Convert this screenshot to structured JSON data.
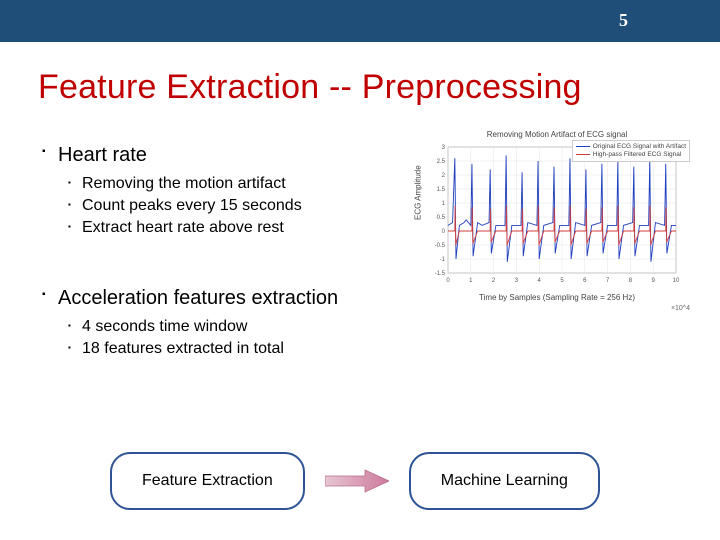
{
  "header": {
    "page_number": "5",
    "accent_color": "#1f4e79"
  },
  "title": "Feature Extraction -- Preprocessing",
  "title_color": "#c00000",
  "bullets": [
    {
      "label": "Heart rate",
      "children": [
        "Removing the motion artifact",
        "Count peaks every 15 seconds",
        "Extract heart rate above rest"
      ]
    },
    {
      "label": "Acceleration features extraction",
      "children": [
        "4 seconds time window",
        "18 features extracted in total"
      ]
    }
  ],
  "flow": {
    "left": "Feature Extraction",
    "right": "Machine Learning",
    "arrow_color": "#d48fad"
  },
  "chart_data": {
    "type": "line",
    "title": "Removing Motion Artifact of ECG signal",
    "xlabel": "Time by Samples (Sampling Rate = 256 Hz)",
    "ylabel": "ECG Amplitude",
    "x_range": [
      0,
      10
    ],
    "y_range": [
      -1.5,
      3.0
    ],
    "x_ticks": [
      0,
      1,
      2,
      3,
      4,
      5,
      6,
      7,
      8,
      9,
      10
    ],
    "y_ticks": [
      -1.5,
      -1.0,
      -0.5,
      0,
      0.5,
      1.0,
      1.5,
      2.0,
      2.5,
      3.0
    ],
    "x_scale_note": "×10^4",
    "series": [
      {
        "name": "Original ECG Signal with Artifact",
        "color": "#1f3fbf",
        "values": [
          [
            0.0,
            0.2
          ],
          [
            0.2,
            0.3
          ],
          [
            0.3,
            2.6
          ],
          [
            0.35,
            -1.0
          ],
          [
            0.5,
            0.2
          ],
          [
            0.7,
            0.3
          ],
          [
            0.8,
            0.4
          ],
          [
            1.0,
            0.2
          ],
          [
            1.05,
            2.4
          ],
          [
            1.1,
            -0.9
          ],
          [
            1.3,
            0.3
          ],
          [
            1.5,
            0.2
          ],
          [
            1.8,
            0.3
          ],
          [
            1.85,
            2.2
          ],
          [
            1.9,
            -0.8
          ],
          [
            2.1,
            0.2
          ],
          [
            2.5,
            0.2
          ],
          [
            2.55,
            2.7
          ],
          [
            2.6,
            -1.1
          ],
          [
            2.8,
            0.2
          ],
          [
            3.2,
            0.2
          ],
          [
            3.25,
            2.1
          ],
          [
            3.3,
            -0.9
          ],
          [
            3.5,
            0.3
          ],
          [
            3.9,
            0.2
          ],
          [
            3.95,
            2.5
          ],
          [
            4.0,
            -1.0
          ],
          [
            4.2,
            0.2
          ],
          [
            4.6,
            0.3
          ],
          [
            4.65,
            2.3
          ],
          [
            4.7,
            -0.8
          ],
          [
            4.9,
            0.2
          ],
          [
            5.3,
            0.2
          ],
          [
            5.35,
            2.6
          ],
          [
            5.4,
            -1.0
          ],
          [
            5.6,
            0.3
          ],
          [
            6.0,
            0.2
          ],
          [
            6.05,
            2.2
          ],
          [
            6.1,
            -0.9
          ],
          [
            6.3,
            0.2
          ],
          [
            6.7,
            0.3
          ],
          [
            6.75,
            2.4
          ],
          [
            6.8,
            -0.8
          ],
          [
            7.0,
            0.2
          ],
          [
            7.4,
            0.2
          ],
          [
            7.45,
            2.5
          ],
          [
            7.5,
            -1.0
          ],
          [
            7.7,
            0.2
          ],
          [
            8.1,
            0.3
          ],
          [
            8.15,
            2.3
          ],
          [
            8.2,
            -0.9
          ],
          [
            8.4,
            0.2
          ],
          [
            8.8,
            0.2
          ],
          [
            8.85,
            2.6
          ],
          [
            8.9,
            -1.1
          ],
          [
            9.1,
            0.3
          ],
          [
            9.5,
            0.2
          ],
          [
            9.55,
            2.4
          ],
          [
            9.6,
            -0.8
          ],
          [
            9.8,
            0.2
          ],
          [
            10.0,
            0.2
          ]
        ]
      },
      {
        "name": "High-pass Filtered ECG Signal",
        "color": "#d23c3c",
        "values": [
          [
            0.0,
            0.0
          ],
          [
            0.3,
            0.0
          ],
          [
            0.31,
            0.9
          ],
          [
            0.34,
            -0.5
          ],
          [
            0.5,
            0.0
          ],
          [
            1.05,
            0.0
          ],
          [
            1.06,
            0.85
          ],
          [
            1.09,
            -0.45
          ],
          [
            1.3,
            0.0
          ],
          [
            1.85,
            0.0
          ],
          [
            1.86,
            0.8
          ],
          [
            1.89,
            -0.4
          ],
          [
            2.1,
            0.0
          ],
          [
            2.55,
            0.0
          ],
          [
            2.56,
            0.9
          ],
          [
            2.59,
            -0.5
          ],
          [
            2.8,
            0.0
          ],
          [
            3.25,
            0.0
          ],
          [
            3.26,
            0.8
          ],
          [
            3.29,
            -0.45
          ],
          [
            3.5,
            0.0
          ],
          [
            3.95,
            0.0
          ],
          [
            3.96,
            0.9
          ],
          [
            3.99,
            -0.5
          ],
          [
            4.2,
            0.0
          ],
          [
            4.65,
            0.0
          ],
          [
            4.66,
            0.85
          ],
          [
            4.69,
            -0.4
          ],
          [
            4.9,
            0.0
          ],
          [
            5.35,
            0.0
          ],
          [
            5.36,
            0.9
          ],
          [
            5.39,
            -0.5
          ],
          [
            5.6,
            0.0
          ],
          [
            6.05,
            0.0
          ],
          [
            6.06,
            0.8
          ],
          [
            6.09,
            -0.45
          ],
          [
            6.3,
            0.0
          ],
          [
            6.75,
            0.0
          ],
          [
            6.76,
            0.85
          ],
          [
            6.79,
            -0.4
          ],
          [
            7.0,
            0.0
          ],
          [
            7.45,
            0.0
          ],
          [
            7.46,
            0.9
          ],
          [
            7.49,
            -0.5
          ],
          [
            7.7,
            0.0
          ],
          [
            8.15,
            0.0
          ],
          [
            8.16,
            0.85
          ],
          [
            8.19,
            -0.45
          ],
          [
            8.4,
            0.0
          ],
          [
            8.85,
            0.0
          ],
          [
            8.86,
            0.9
          ],
          [
            8.89,
            -0.5
          ],
          [
            9.1,
            0.0
          ],
          [
            9.55,
            0.0
          ],
          [
            9.56,
            0.85
          ],
          [
            9.59,
            -0.4
          ],
          [
            9.8,
            0.0
          ],
          [
            10.0,
            0.0
          ]
        ]
      }
    ]
  }
}
